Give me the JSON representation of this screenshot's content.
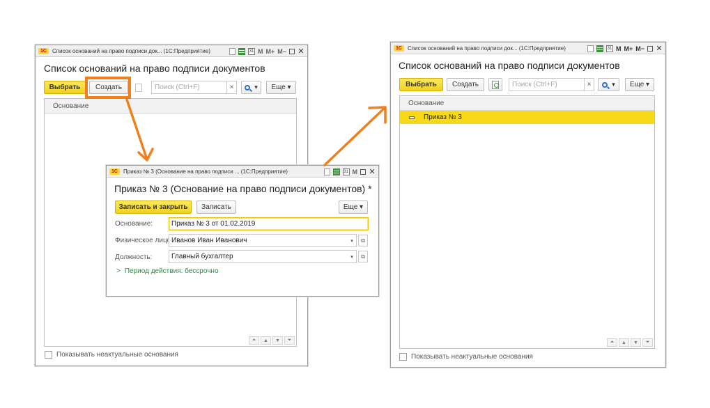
{
  "left_window": {
    "title": "Список оснований на право подписи док...  (1С:Предприятие)",
    "heading": "Список оснований на право подписи документов",
    "select_label": "Выбрать",
    "create_label": "Создать",
    "search_placeholder": "Поиск (Ctrl+F)",
    "clear_label": "×",
    "more_label": "Еще ▾",
    "column_header": "Основание",
    "checkbox_label": "Показывать неактуальные основания",
    "titlebar_m": "M",
    "titlebar_mplus": "M+",
    "titlebar_mminus": "M−"
  },
  "dialog": {
    "title": "Приказ № 3 (Основание на право подписи ...  (1С:Предприятие)",
    "heading": "Приказ № 3 (Основание на право подписи документов) *",
    "save_close_label": "Записать и закрыть",
    "save_label": "Записать",
    "more_label": "Еще ▾",
    "fields": [
      {
        "label": "Основание:",
        "value": "Приказ № 3 от 01.02.2019"
      },
      {
        "label": "Физическое лицо:",
        "value": "Иванов Иван Иванович"
      },
      {
        "label": "Должность:",
        "value": "Главный бухгалтер"
      }
    ],
    "period_label": "Период действия: бессрочно"
  },
  "right_window": {
    "title": "Список оснований на право подписи док...  (1С:Предприятие)",
    "heading": "Список оснований на право подписи документов",
    "select_label": "Выбрать",
    "create_label": "Создать",
    "search_placeholder": "Поиск (Ctrl+F)",
    "clear_label": "×",
    "more_label": "Еще ▾",
    "column_header": "Основание",
    "rows": [
      "Приказ № 3"
    ],
    "checkbox_label": "Показывать неактуальные основания"
  },
  "colors": {
    "accent_yellow": "#f7d917",
    "highlight_orange": "#f07f1d",
    "period_green": "#2e8b3f"
  },
  "logo_text": "1С"
}
